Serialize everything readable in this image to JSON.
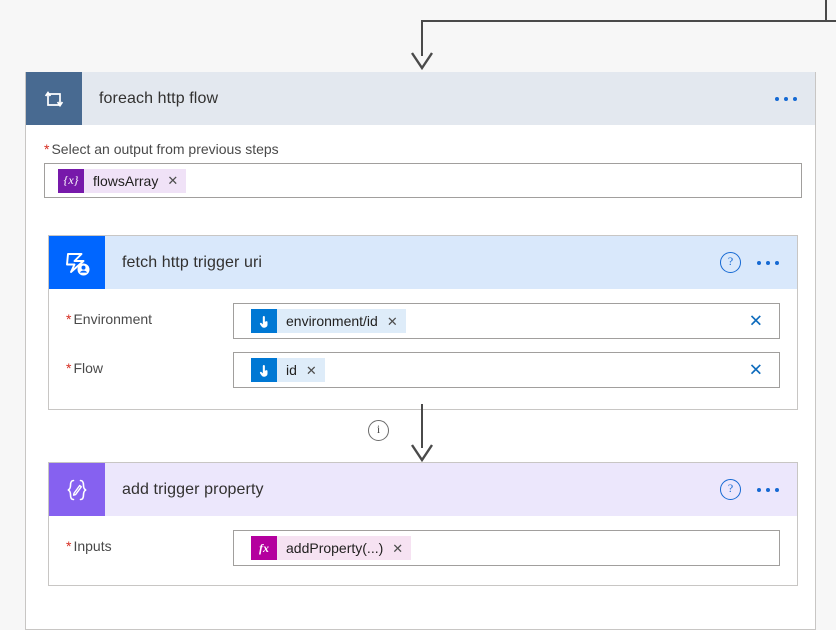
{
  "connectors": {
    "top_arrow_name": "incoming-flow-arrow",
    "mid_arrow_name": "between-actions-arrow",
    "info_tooltip_glyph": "i"
  },
  "scope": {
    "title": "foreach http flow",
    "icon": "foreach-loop-icon",
    "more_label": "More commands",
    "field": {
      "label": "Select an output from previous steps",
      "required_marker": "*",
      "token": {
        "icon_glyph": "{x}",
        "icon_name": "variable-token-icon",
        "text": "flowsArray",
        "remove_glyph": "✕"
      }
    }
  },
  "actions": [
    {
      "id": "fetch-http-trigger-uri",
      "title": "fetch http trigger uri",
      "icon": "power-automate-flow-icon",
      "help_glyph": "?",
      "more_label": "More commands",
      "params": [
        {
          "name": "Environment",
          "required_marker": "*",
          "token": {
            "icon_name": "pointer-hand-icon",
            "text": "environment/id",
            "remove_glyph": "✕"
          },
          "clear_glyph": "✕"
        },
        {
          "name": "Flow",
          "required_marker": "*",
          "token": {
            "icon_name": "pointer-hand-icon",
            "text": "id",
            "remove_glyph": "✕"
          },
          "clear_glyph": "✕"
        }
      ]
    },
    {
      "id": "add-trigger-property",
      "title": "add trigger property",
      "icon": "compose-braces-icon",
      "help_glyph": "?",
      "more_label": "More commands",
      "params": [
        {
          "name": "Inputs",
          "required_marker": "*",
          "token": {
            "icon_glyph": "fx",
            "icon_name": "expression-function-icon",
            "text": "addProperty(...)",
            "remove_glyph": "✕"
          }
        }
      ]
    }
  ],
  "colors": {
    "canvas": "#f7f7f7",
    "scope_header": "#e3e8ef",
    "scope_icon": "#486a91",
    "fetch_header": "#d9e8fb",
    "fetch_icon": "#0066ff",
    "addprop_header": "#ece7fc",
    "addprop_icon": "#8661f0",
    "accent_blue": "#1569d3",
    "required_red": "#d62c20",
    "variable_purple": "#7719aa",
    "expression_magenta": "#b4009e"
  }
}
